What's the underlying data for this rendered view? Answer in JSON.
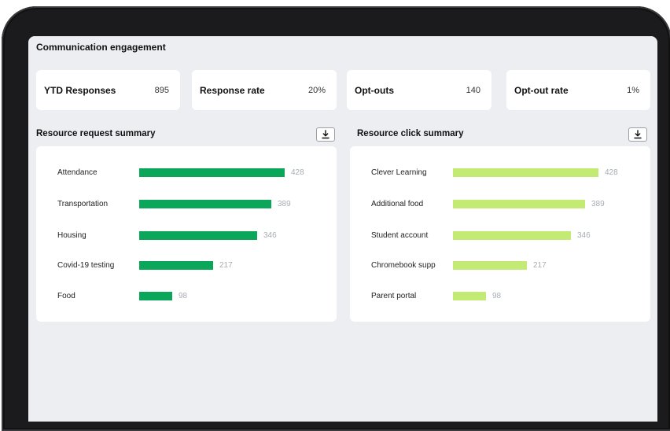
{
  "page_title": "Communication engagement",
  "stats": [
    {
      "label": "YTD Responses",
      "value": "895"
    },
    {
      "label": "Response rate",
      "value": "20%"
    },
    {
      "label": "Opt-outs",
      "value": "140"
    },
    {
      "label": "Opt-out rate",
      "value": "1%"
    }
  ],
  "colors": {
    "request_bar": "#0aa65a",
    "click_bar": "#c3ea72",
    "screen_bg": "#eceef2",
    "device_frame": "#1b1b1d"
  },
  "icons": {
    "download": "download-icon"
  },
  "request_summary": {
    "title": "Resource request summary",
    "max": 428,
    "items": [
      {
        "label": "Attendance",
        "value": 428,
        "value_text": "428"
      },
      {
        "label": "Transportation",
        "value": 389,
        "value_text": "389"
      },
      {
        "label": "Housing",
        "value": 346,
        "value_text": "346"
      },
      {
        "label": "Covid-19 testing",
        "value": 217,
        "value_text": "217"
      },
      {
        "label": "Food",
        "value": 98,
        "value_text": "98"
      }
    ]
  },
  "click_summary": {
    "title": "Resource click summary",
    "max": 428,
    "items": [
      {
        "label": "Clever Learning",
        "value": 428,
        "value_text": "428"
      },
      {
        "label": "Additional food",
        "value": 389,
        "value_text": "389"
      },
      {
        "label": "Student account",
        "value": 346,
        "value_text": "346"
      },
      {
        "label": "Chromebook supp",
        "value": 217,
        "value_text": "217"
      },
      {
        "label": "Parent portal",
        "value": 98,
        "value_text": "98"
      }
    ]
  }
}
